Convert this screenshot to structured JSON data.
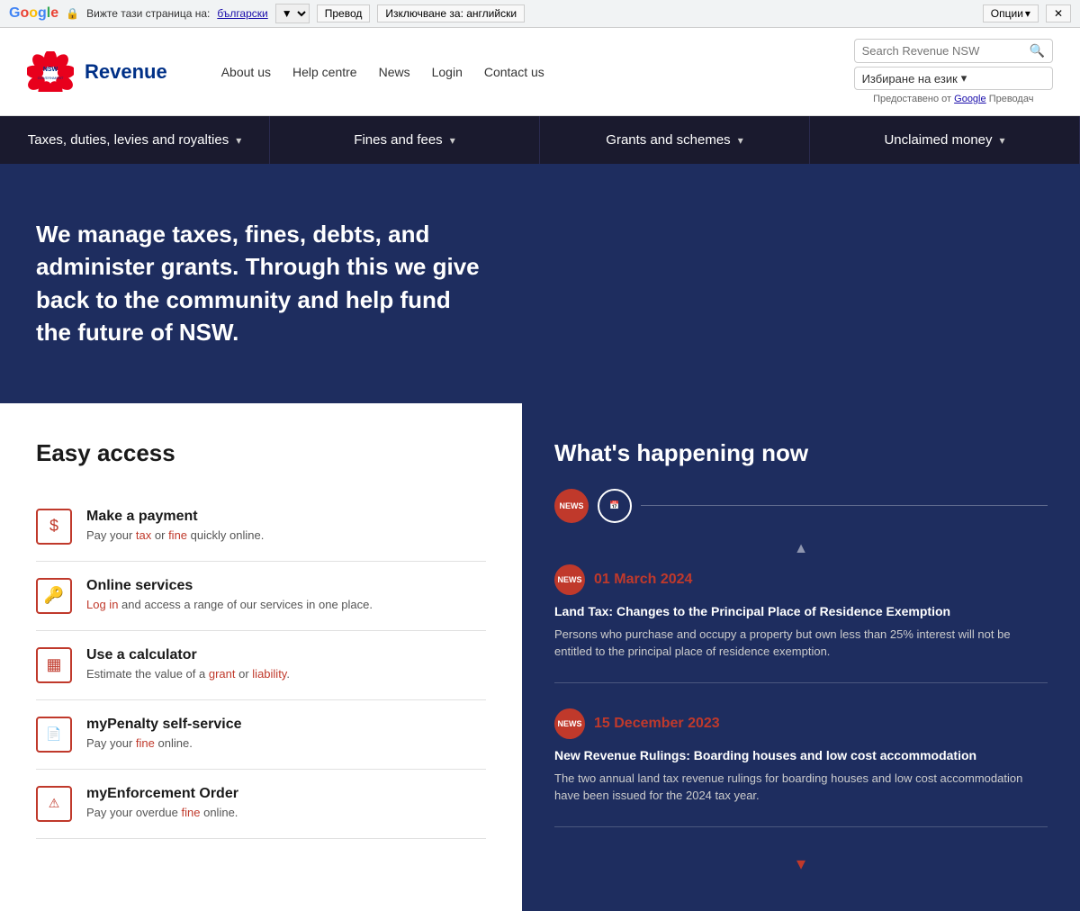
{
  "translate_bar": {
    "see_page": "Вижте тази страница на:",
    "language": "български",
    "translate_btn": "Превод",
    "exclude_btn": "Изключване за: английски",
    "options_btn": "Опции",
    "lock_symbol": "🔒"
  },
  "header": {
    "logo_text": "NSW",
    "gov_text": "GOVERNMENT",
    "revenue_title": "Revenue",
    "nav": {
      "about": "About us",
      "help": "Help centre",
      "news": "News",
      "login": "Login",
      "contact": "Contact us"
    },
    "search_placeholder": "Search Revenue NSW",
    "language_select": "Избиране на език",
    "translate_credit": "Предоставено от",
    "translate_link": "Google",
    "translate_word": "Преводач"
  },
  "main_nav": {
    "items": [
      {
        "label": "Taxes, duties, levies and royalties",
        "arrow": "▾"
      },
      {
        "label": "Fines and fees",
        "arrow": "▾"
      },
      {
        "label": "Grants and schemes",
        "arrow": "▾"
      },
      {
        "label": "Unclaimed money",
        "arrow": "▾"
      }
    ]
  },
  "hero": {
    "text": "We manage taxes, fines, debts, and administer grants. Through this we give back to the community and help fund the future of NSW."
  },
  "easy_access": {
    "heading": "Easy access",
    "items": [
      {
        "icon": "$",
        "title": "Make a payment",
        "text_before": "Pay your ",
        "link1": "tax",
        "text_mid": " or ",
        "link2": "fine",
        "text_after": " quickly online.",
        "id": "make-payment"
      },
      {
        "icon": "🔑",
        "title": "Online services",
        "text_before": "Log in",
        "link1": "",
        "text_mid": " and access a range of our services in one place.",
        "link2": "",
        "text_after": "",
        "id": "online-services"
      },
      {
        "icon": "▦",
        "title": "Use a calculator",
        "text_before": "Estimate the value of a ",
        "link1": "grant",
        "text_mid": " or ",
        "link2": "liability",
        "text_after": ".",
        "id": "calculator"
      },
      {
        "icon": "📄",
        "title": "myPenalty self-service",
        "text_before": "Pay your ",
        "link1": "fine",
        "text_mid": " online.",
        "link2": "",
        "text_after": "",
        "id": "mypenalty"
      },
      {
        "icon": "⚠",
        "title": "myEnforcement Order",
        "text_before": "Pay your overdue ",
        "link1": "fine",
        "text_mid": " online.",
        "link2": "",
        "text_after": "",
        "id": "enforcement"
      }
    ]
  },
  "news_panel": {
    "heading": "What's happening now",
    "tab1_label": "NEWS",
    "tab2_label": "📅",
    "items": [
      {
        "badge": "NEWS",
        "date": "01 March 2024",
        "title": "Land Tax: Changes to the Principal Place of Residence Exemption",
        "desc": "Persons who purchase and occupy a property but own less than 25% interest will not be entitled to the principal place of residence exemption."
      },
      {
        "badge": "NEWS",
        "date": "15 December 2023",
        "title": "New Revenue Rulings: Boarding houses and low cost accommodation",
        "desc": "The two annual land tax revenue rulings for boarding houses and low cost accommodation have been issued for the 2024 tax year."
      }
    ]
  }
}
